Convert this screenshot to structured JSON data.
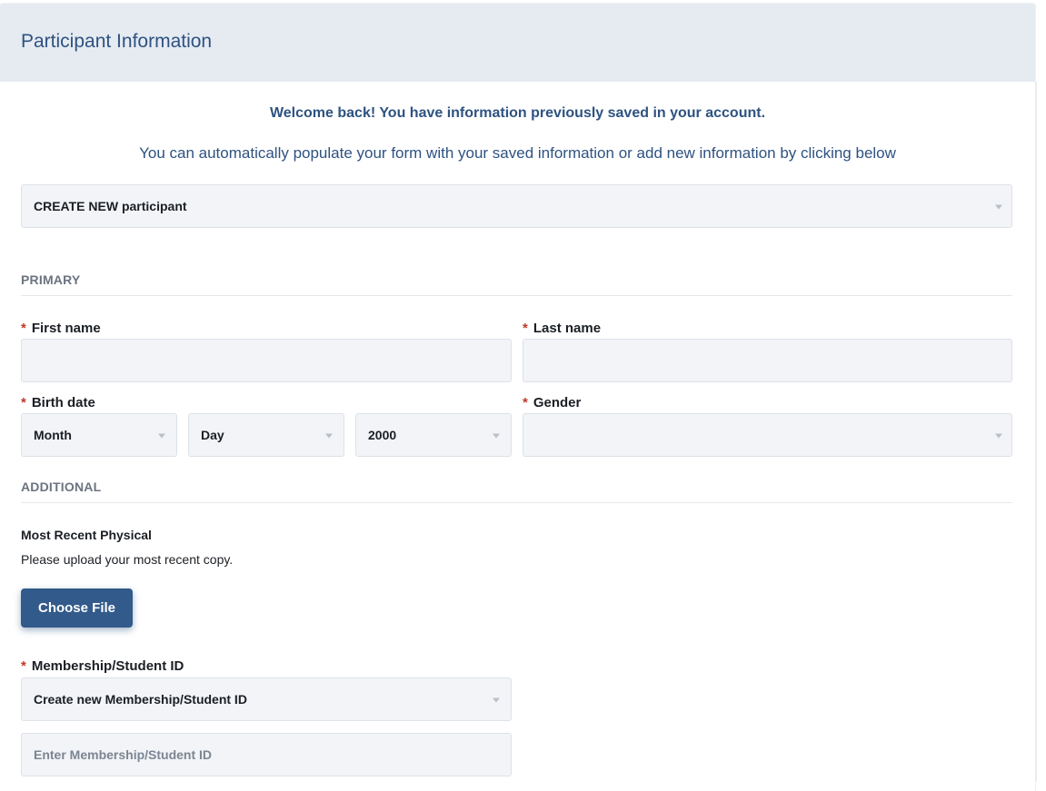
{
  "header": {
    "title": "Participant Information"
  },
  "intro": {
    "welcome": "Welcome back! You have information previously saved in your account.",
    "subtext": "You can automatically populate your form with your saved information or add new information by clicking below"
  },
  "participant_select": {
    "value": "CREATE NEW participant"
  },
  "primary": {
    "section_label": "PRIMARY",
    "first_name": {
      "label": "First name",
      "value": ""
    },
    "last_name": {
      "label": "Last name",
      "value": ""
    },
    "birth_date": {
      "label": "Birth date",
      "month": "Month",
      "day": "Day",
      "year": "2000"
    },
    "gender": {
      "label": "Gender",
      "value": ""
    }
  },
  "additional": {
    "section_label": "ADDITIONAL",
    "physical": {
      "label": "Most Recent Physical",
      "helper": "Please upload your most recent copy.",
      "button": "Choose File"
    },
    "membership": {
      "label": "Membership/Student ID",
      "select_value": "Create new Membership/Student ID",
      "input_placeholder": "Enter Membership/Student ID"
    }
  },
  "required_marker": "*",
  "colors": {
    "accent": "#2e5281",
    "button": "#325a8a",
    "header_bg": "#e6ebf2",
    "field_bg": "#f2f4f7",
    "required": "#c0392b"
  },
  "icons": {
    "dropdown": "caret-down-icon"
  }
}
